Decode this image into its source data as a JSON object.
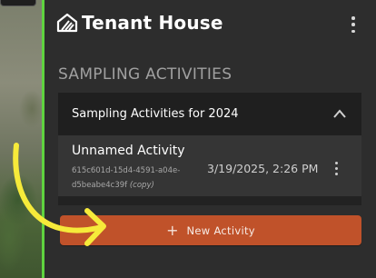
{
  "app": {
    "title": "Tenant House",
    "logo_icon": "tenant-house-logo-icon",
    "menu_icon": "kebab-menu-icon"
  },
  "section": {
    "title": "SAMPLING ACTIVITIES"
  },
  "accordion": {
    "title": "Sampling Activities for 2024",
    "expanded": true,
    "toggle_icon": "chevron-up-icon",
    "activities": [
      {
        "name": "Unnamed Activity",
        "id": "615c601d-15d4-4591-a04e-d5beabe4c39f",
        "copy_tag": "(copy)",
        "datetime": "3/19/2025, 2:26 PM",
        "menu_icon": "kebab-menu-icon"
      }
    ]
  },
  "actions": {
    "new_activity_label": "New Activity",
    "new_activity_icon": "plus-icon"
  },
  "annotation": {
    "icon": "curved-arrow-icon",
    "color": "#f6ea3a"
  },
  "colors": {
    "accent_green": "#5fd33f",
    "button": "#c0522a",
    "panel": "#2d2d2d"
  }
}
